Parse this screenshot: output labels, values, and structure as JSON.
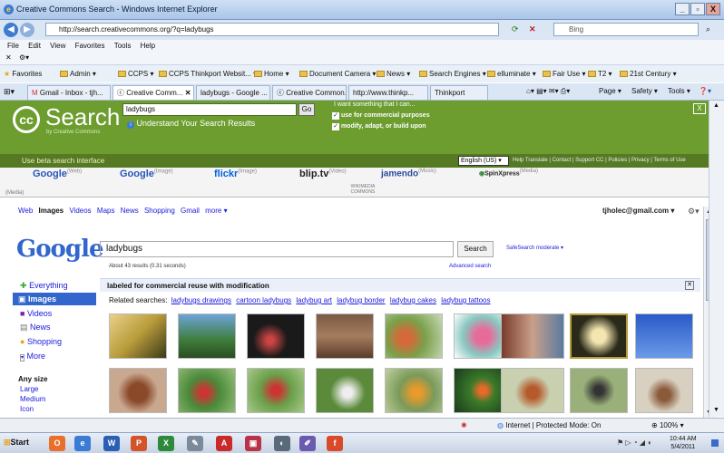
{
  "window": {
    "title": "Creative Commons Search - Windows Internet Explorer"
  },
  "address": {
    "url": "http://search.creativecommons.org/?q=ladybugs",
    "search_placeholder": "Bing"
  },
  "menu": [
    "File",
    "Edit",
    "View",
    "Favorites",
    "Tools",
    "Help"
  ],
  "favorites": {
    "label": "Favorites",
    "items": [
      "Admin ▾",
      "CCPS ▾",
      "CCPS Thinkport Websit... ▾",
      "Home ▾",
      "Document Camera ▾",
      "News ▾",
      "Search Engines ▾",
      "elluminate ▾",
      "Fair Use ▾",
      "T2 ▾",
      "21st Century ▾"
    ]
  },
  "tabs": [
    "Gmail - Inbox - tjh...",
    "Creative Comm...",
    "ladybugs - Google ...",
    "Creative Common...",
    "http://www.thinkp...",
    "Thinkport"
  ],
  "ie_commands": [
    "Page ▾",
    "Safety ▾",
    "Tools ▾"
  ],
  "cc": {
    "logo_text": "Search",
    "logo_sub": "by Creative Commons",
    "query": "ladybugs",
    "go_label": "Go",
    "understand_link": "Understand Your Search Results",
    "options_title": "I want something that I can...",
    "option_commercial": "use for commercial purposes",
    "option_modify": "modify, adapt, or build upon",
    "close_label": "X",
    "beta_link": "Use beta search interface",
    "language": "English (US)",
    "footer_links": "Help Translate | Contact | Support CC | Policies | Privacy | Terms of Use",
    "engines": [
      {
        "name": "Google",
        "sub": "(Web)"
      },
      {
        "name": "Google",
        "sub": "(Image)"
      },
      {
        "name": "flickr",
        "sub": "(Image)"
      },
      {
        "name": "blip.tv",
        "sub": "(Video)"
      },
      {
        "name": "jamendo",
        "sub": "(Music)"
      },
      {
        "name": "SpinXpress",
        "sub": "(Media)"
      }
    ],
    "wikimedia": "WIKIMEDIA COMMONS",
    "wikimedia_sub": "(Media)"
  },
  "google": {
    "top_links": [
      "Web",
      "Images",
      "Videos",
      "Maps",
      "News",
      "Shopping",
      "Gmail",
      "more ▾"
    ],
    "account": "tjholec@gmail.com ▾",
    "logo": "Google",
    "query": "ladybugs",
    "search_button": "Search",
    "safesearch": "SafeSearch moderate ▾",
    "results_count": "About 43 results (0.31 seconds)",
    "advanced": "Advanced search",
    "side_nav": [
      "Everything",
      "Images",
      "Videos",
      "News",
      "Shopping",
      "More"
    ],
    "size_heading": "Any size",
    "sizes": [
      "Large",
      "Medium",
      "Icon"
    ],
    "filter_label": "labeled for commercial reuse with modification",
    "related_label": "Related searches:",
    "related": [
      "ladybugs drawings",
      "cartoon ladybugs",
      "ladybug art",
      "ladybug border",
      "ladybug cakes",
      "ladybug tattoos"
    ]
  },
  "status": {
    "zone": "Internet | Protected Mode: On",
    "zoom": "100%"
  },
  "taskbar": {
    "start": "Start",
    "time": "10:44 AM",
    "date": "5/4/2011"
  },
  "colors": {
    "cc_green": "#6c9d2e",
    "cc_dark": "#557a23",
    "google_blue": "#1a1adb"
  }
}
